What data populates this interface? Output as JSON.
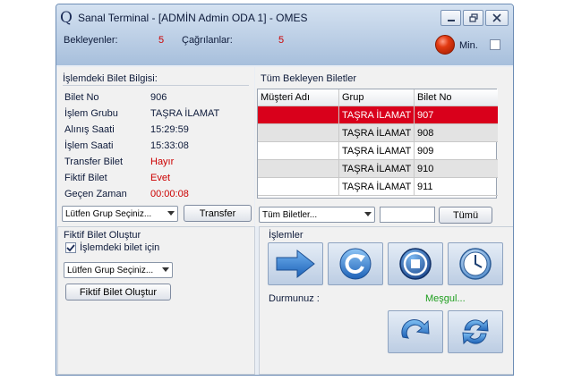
{
  "window": {
    "title": "Sanal Terminal - [ADMİN Admin ODA 1] -  OMES",
    "app_icon_glyph": "Q"
  },
  "counts": {
    "waiting_label": "Bekleyenler:",
    "waiting_value": "5",
    "called_label": "Çağrılanlar:",
    "called_value": "5"
  },
  "status": {
    "led_color": "#e23a12",
    "min_label": "Min."
  },
  "ticket_info": {
    "title": "İşlemdeki Bilet Bilgisi:",
    "rows": [
      {
        "label": "Bilet No",
        "value": "906",
        "color": "normal"
      },
      {
        "label": "İşlem Grubu",
        "value": "TAŞRA İLAMAT",
        "color": "normal"
      },
      {
        "label": "Alınış Saati",
        "value": "15:29:59",
        "color": "normal"
      },
      {
        "label": "İşlem Saati",
        "value": "15:33:08",
        "color": "normal"
      },
      {
        "label": "Transfer Bilet",
        "value": "Hayır",
        "color": "red"
      },
      {
        "label": "Fiktif Bilet",
        "value": "Evet",
        "color": "red"
      },
      {
        "label": "Geçen Zaman",
        "value": "00:00:08",
        "color": "red"
      }
    ],
    "group_combo": "Lütfen Grup Seçiniz...",
    "transfer_button": "Transfer"
  },
  "waiting_tickets": {
    "title": "Tüm Bekleyen Biletler",
    "columns": [
      "Müşteri Adı",
      "Grup",
      "Bilet No"
    ],
    "rows": [
      {
        "customer": "",
        "group": "TAŞRA İLAMAT",
        "ticket": "907",
        "selected": true
      },
      {
        "customer": "",
        "group": "TAŞRA İLAMAT",
        "ticket": "908",
        "selected": false
      },
      {
        "customer": "",
        "group": "TAŞRA İLAMAT",
        "ticket": "909",
        "selected": false
      },
      {
        "customer": "",
        "group": "TAŞRA İLAMAT",
        "ticket": "910",
        "selected": false
      },
      {
        "customer": "",
        "group": "TAŞRA İLAMAT",
        "ticket": "911",
        "selected": false
      }
    ],
    "filter_combo": "Tüm Biletler...",
    "search_value": "",
    "all_button": "Tümü"
  },
  "fictive": {
    "title": "Fiktif Bilet Oluştur",
    "checkbox_label": "İşlemdeki bilet için",
    "checkbox_checked": true,
    "group_combo": "Lütfen Grup Seçiniz...",
    "create_button": "Fiktif Bilet Oluştur"
  },
  "operations": {
    "title": "İşlemler",
    "buttons": [
      {
        "name": "next-arrow-icon"
      },
      {
        "name": "refresh-icon"
      },
      {
        "name": "stop-icon"
      },
      {
        "name": "clock-icon"
      }
    ],
    "status_label": "Durmunuz  :",
    "status_value": "Meşgul...",
    "status_color": "#1e9e1e",
    "bottom_buttons": [
      {
        "name": "redo-icon"
      },
      {
        "name": "sync-icon"
      }
    ]
  },
  "colors": {
    "accent_blue": "#2f7fd2",
    "selected_row": "#d9001b"
  }
}
